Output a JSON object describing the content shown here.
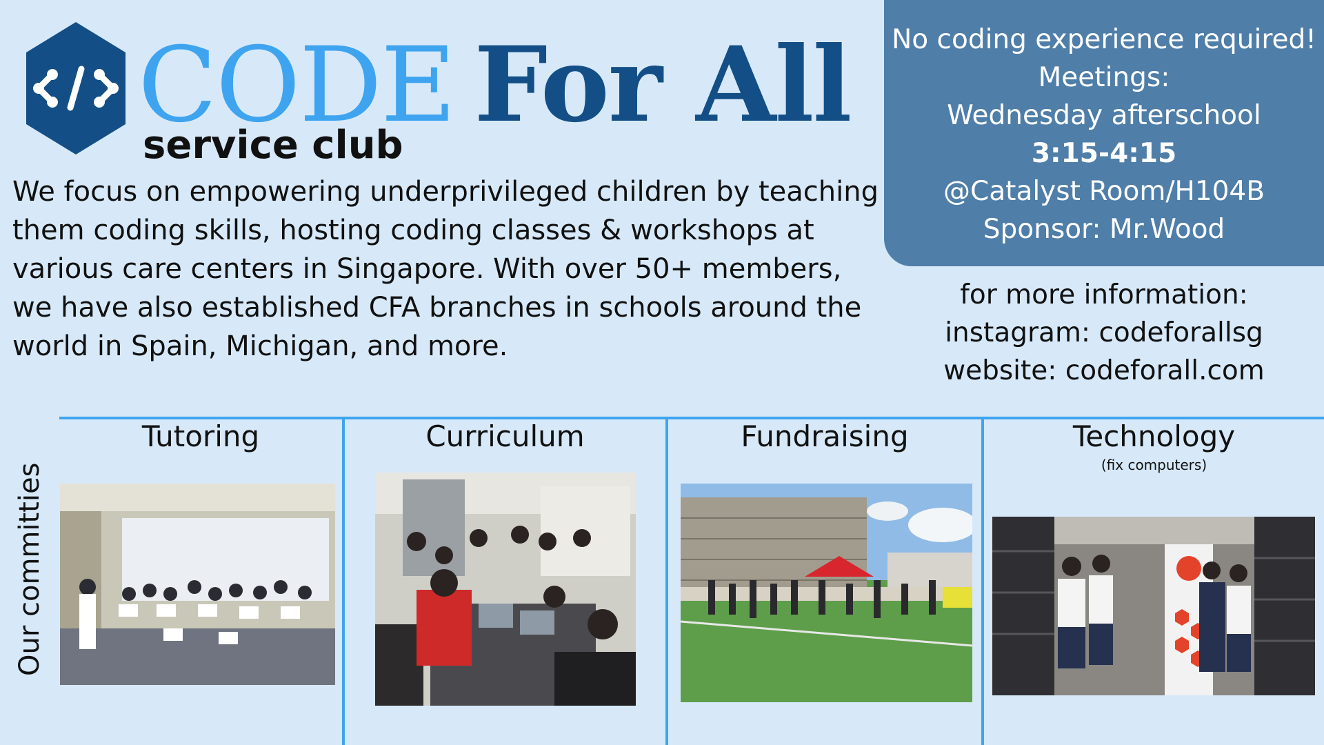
{
  "logo": {
    "icon": "code-brackets-icon",
    "title_code": "CODE",
    "title_forall": "For All",
    "subtitle": "service club"
  },
  "description": "We focus on empowering underprivileged children by teaching them coding skills, hosting coding classes & workshops at various care centers in Singapore. With over 50+ members, we have also established CFA branches in schools around the world in Spain, Michigan, and more.",
  "info": {
    "line1": "No coding experience required!",
    "line2": "Meetings:",
    "line3": "Wednesday afterschool",
    "line4": "3:15-4:15",
    "line5": "@Catalyst Room/H104B",
    "line6": "Sponsor: Mr.Wood"
  },
  "contact": {
    "line1": "for more information:",
    "line2": "instagram: codeforallsg",
    "line3": "website: codeforall.com"
  },
  "committees": {
    "label": "Our committies",
    "items": [
      {
        "name": "Tutoring",
        "note": ""
      },
      {
        "name": "Curriculum",
        "note": ""
      },
      {
        "name": "Fundraising",
        "note": ""
      },
      {
        "name": "Technology",
        "note": "(fix computers)"
      }
    ]
  },
  "colors": {
    "background": "#d7e9f9",
    "accent_light": "#3fa4ef",
    "accent_dark": "#134f86",
    "info_box": "#4f7ea8"
  }
}
